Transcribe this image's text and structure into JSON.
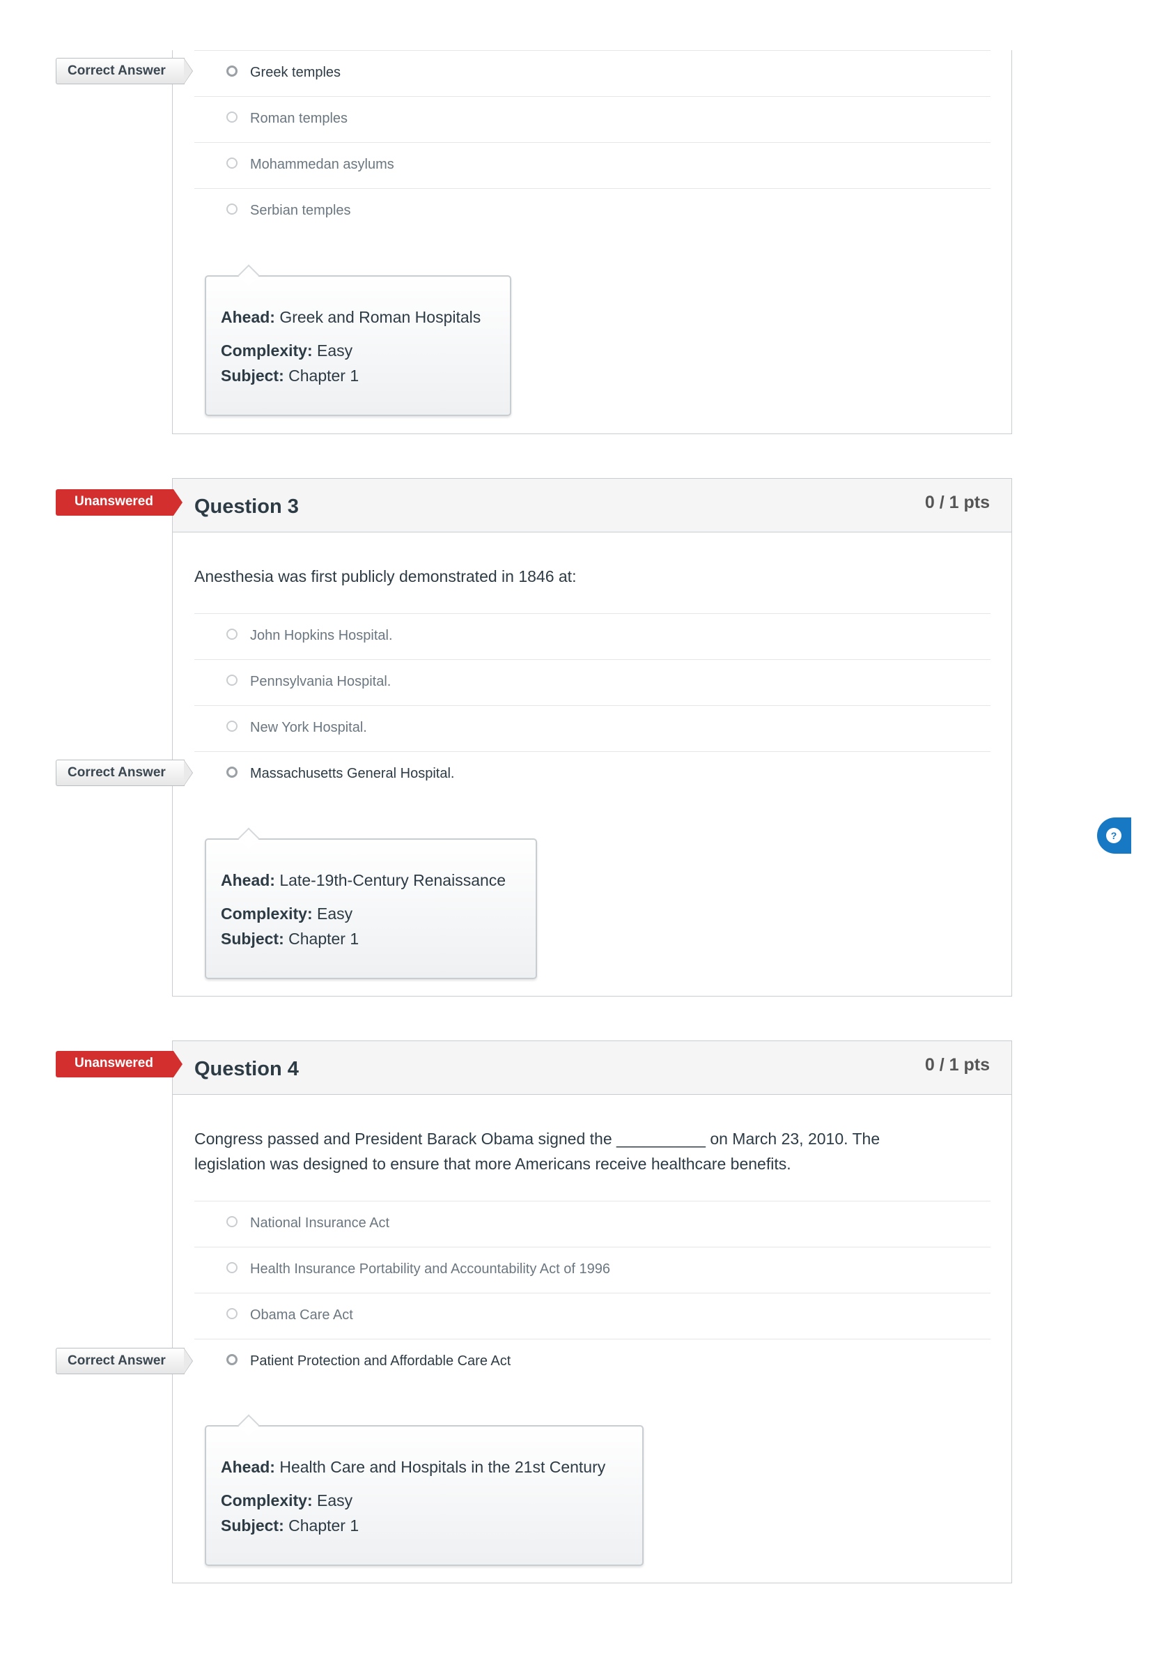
{
  "labels": {
    "correct_answer": "Correct Answer",
    "unanswered": "Unanswered",
    "ahead": "Ahead:",
    "complexity": "Complexity:",
    "subject": "Subject:"
  },
  "colors": {
    "unanswered_tag": "#d32f2f",
    "accent_button": "#1779c4"
  },
  "question2_tail": {
    "answers": [
      "Greek temples",
      "Roman temples",
      "Mohammedan asylums",
      "Serbian temples"
    ],
    "correct_index": 0,
    "meta": {
      "ahead": "Greek and Roman Hospitals",
      "complexity": "Easy",
      "subject": "Chapter 1"
    }
  },
  "question3": {
    "title": "Question 3",
    "points": "0 / 1 pts",
    "status": "Unanswered",
    "text": "Anesthesia was first publicly demonstrated in 1846 at:",
    "answers": [
      "John Hopkins Hospital.",
      "Pennsylvania Hospital.",
      "New York Hospital.",
      "Massachusetts General Hospital."
    ],
    "correct_index": 3,
    "meta": {
      "ahead": "Late-19th-Century Renaissance",
      "complexity": "Easy",
      "subject": "Chapter 1"
    }
  },
  "question4": {
    "title": "Question 4",
    "points": "0 / 1 pts",
    "status": "Unanswered",
    "text_line1": "Congress passed and President Barack Obama signed the __________ on March 23, 2010. The",
    "text_line2": "legislation was designed to ensure that more Americans receive healthcare benefits.",
    "answers": [
      "National Insurance Act",
      "Health Insurance Portability and Accountability Act of 1996",
      "Obama Care Act",
      "Patient Protection and Affordable Care Act"
    ],
    "correct_index": 3,
    "meta": {
      "ahead": "Health Care and Hospitals in the 21st Century",
      "complexity": "Easy",
      "subject": "Chapter 1"
    }
  },
  "floating_button": {
    "icon": "help-icon"
  }
}
